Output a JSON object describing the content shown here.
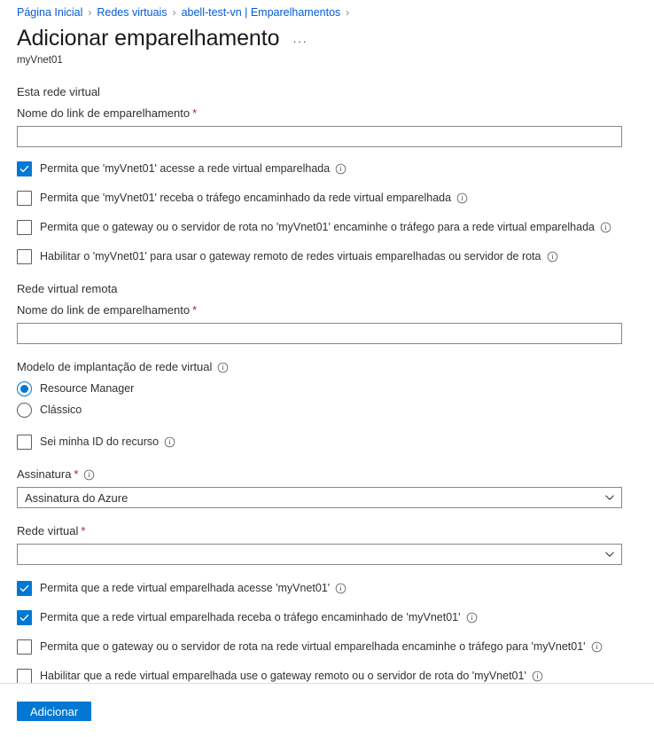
{
  "breadcrumb": {
    "separator": "›",
    "items": [
      {
        "label": "Página Inicial"
      },
      {
        "label": "Redes virtuais"
      },
      {
        "label": "abell-test-vn | Emparelhamentos"
      }
    ]
  },
  "header": {
    "title": "Adicionar emparelhamento",
    "ellipsis": "···",
    "subtitle": "myVnet01"
  },
  "local_section": {
    "heading": "Esta rede virtual",
    "peering_link_name": {
      "label": "Nome do link de emparelhamento",
      "required": "*",
      "value": "",
      "placeholder": ""
    },
    "checkboxes": [
      {
        "label": "Permita que 'myVnet01' acesse a rede virtual emparelhada",
        "checked": true,
        "info": "ⓘ"
      },
      {
        "label": "Permita que 'myVnet01' receba o tráfego encaminhado da rede virtual emparelhada",
        "checked": false,
        "info": "ⓘ"
      },
      {
        "label": "Permita que o gateway ou o servidor de rota no 'myVnet01' encaminhe o tráfego para a rede virtual emparelhada",
        "checked": false,
        "info": "ⓘ"
      },
      {
        "label": "Habilitar o 'myVnet01' para usar o gateway remoto de redes virtuais emparelhadas ou servidor de rota",
        "checked": false,
        "info": "ⓘ"
      }
    ]
  },
  "remote_section": {
    "heading": "Rede virtual remota",
    "peering_link_name": {
      "label": "Nome do link de emparelhamento",
      "required": "*",
      "value": "",
      "placeholder": ""
    },
    "deployment_model": {
      "label": "Modelo de implantação de rede virtual",
      "info": "ⓘ",
      "options": [
        {
          "label": "Resource Manager",
          "selected": true
        },
        {
          "label": "Clássico",
          "selected": false
        }
      ]
    },
    "know_resource_id": {
      "label": "Sei minha ID do recurso",
      "checked": false,
      "info": "ⓘ"
    },
    "subscription": {
      "label": "Assinatura",
      "required": "*",
      "info": "ⓘ",
      "value": "Assinatura do Azure"
    },
    "virtual_network": {
      "label": "Rede virtual",
      "required": "*",
      "value": ""
    },
    "checkboxes": [
      {
        "label": "Permita que a rede virtual emparelhada acesse 'myVnet01'",
        "checked": true,
        "info": "ⓘ"
      },
      {
        "label": "Permita que a rede virtual emparelhada receba o tráfego encaminhado de 'myVnet01'",
        "checked": true,
        "info": "ⓘ"
      },
      {
        "label": "Permita que o gateway ou o servidor de rota na rede virtual emparelhada encaminhe o tráfego para 'myVnet01'",
        "checked": false,
        "info": "ⓘ"
      },
      {
        "label": "Habilitar que a rede virtual emparelhada use o gateway remoto ou o servidor de rota do 'myVnet01'",
        "checked": false,
        "info": "ⓘ"
      }
    ]
  },
  "footer": {
    "submit_label": "Adicionar"
  },
  "colors": {
    "accent": "#0078d4",
    "link": "#015cda",
    "required": "#a4262c",
    "border": "#8a8886",
    "text": "#323130"
  }
}
